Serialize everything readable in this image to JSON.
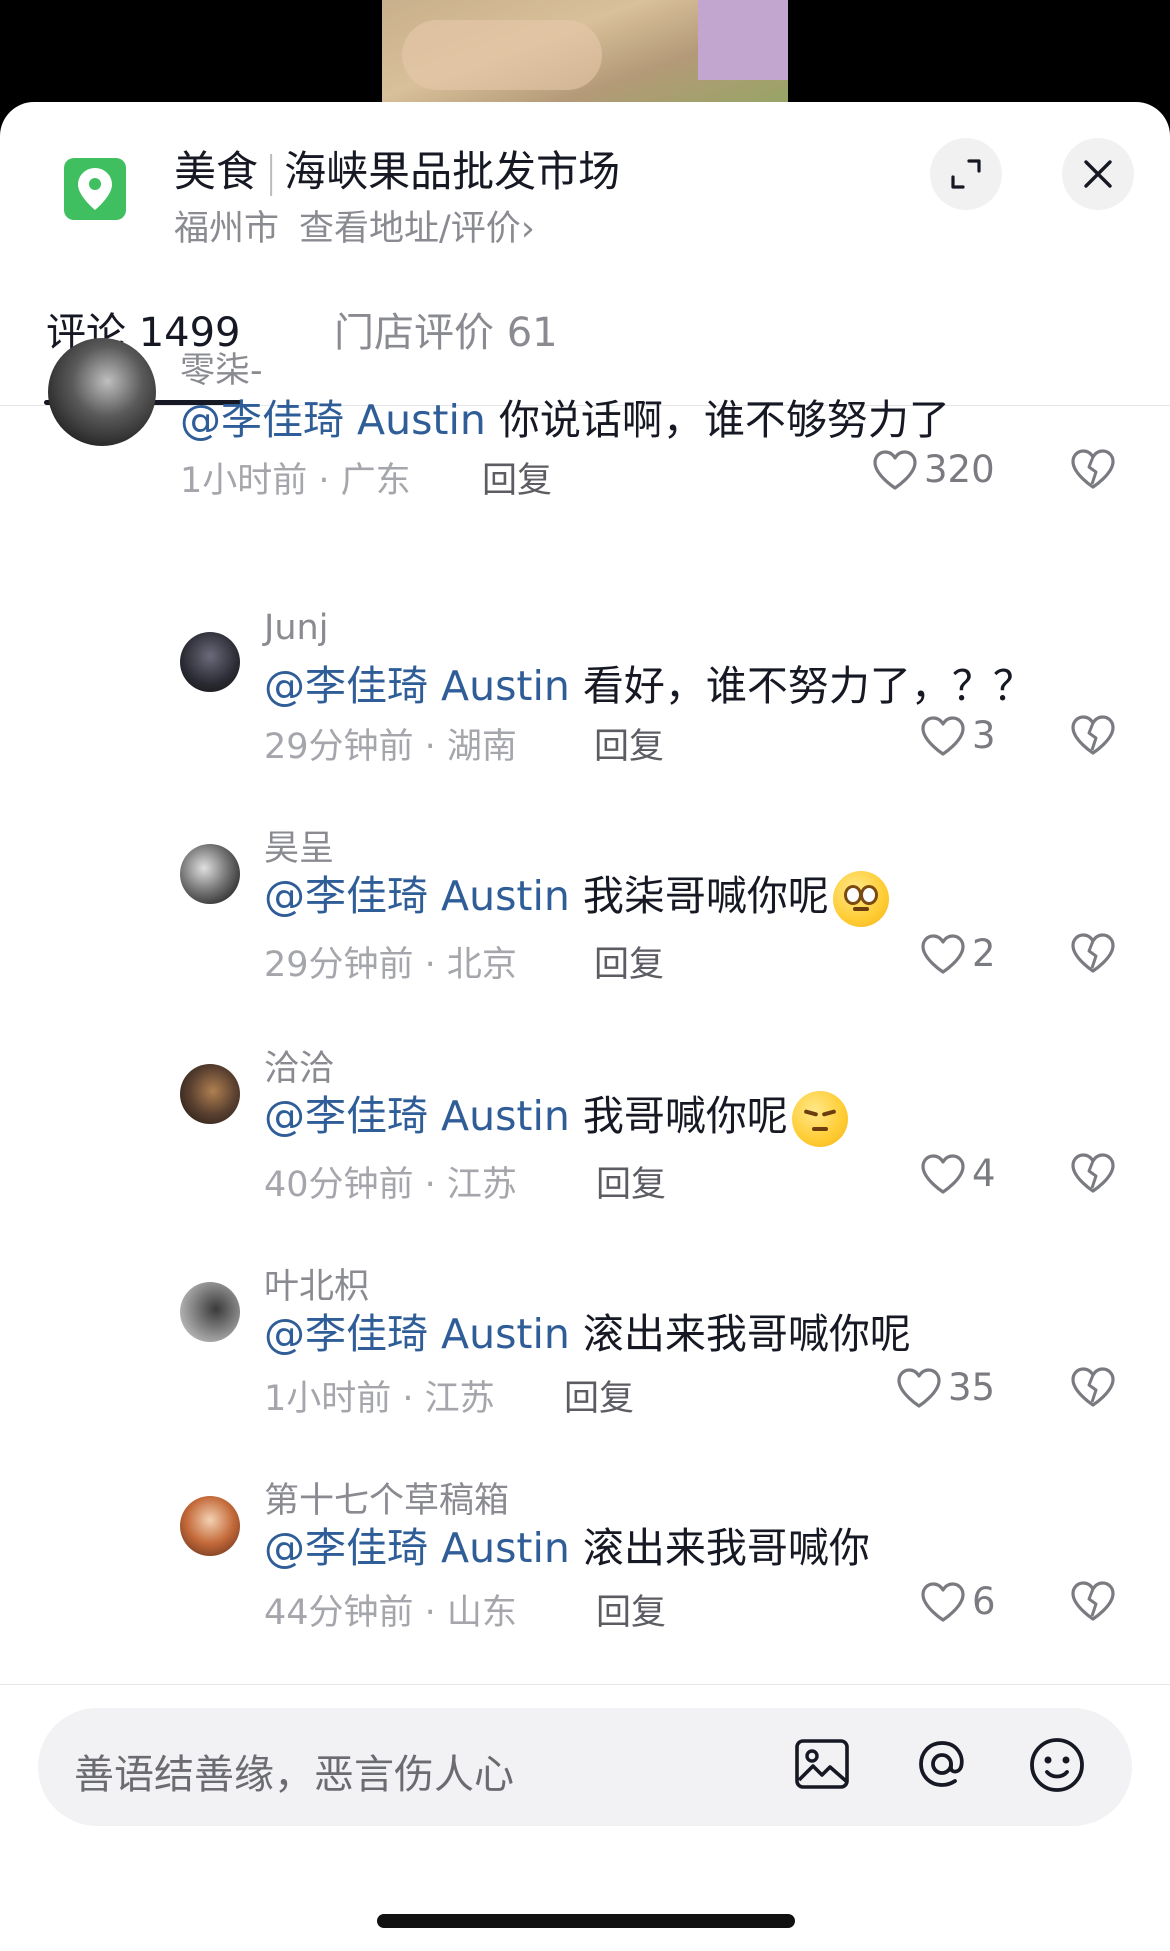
{
  "header": {
    "category": "美食",
    "place_name": "海峡果品批发市场",
    "city": "福州市",
    "address_link": "查看地址/评价",
    "chevron": "›"
  },
  "icons": {
    "location": "location-pin-icon",
    "expand": "expand-icon",
    "close": "close-icon",
    "image": "image-icon",
    "at": "at-mention-icon",
    "emoji": "emoji-icon"
  },
  "tabs": [
    {
      "label": "评论 1499",
      "active": true
    },
    {
      "label": "门店评价 61",
      "active": false
    }
  ],
  "comments": [
    {
      "username": "零柒-",
      "mention": "@李佳琦 Austin",
      "text": " 你说话啊，谁不够努力了",
      "time_location": "1小时前 · 广东",
      "reply_label": "回复",
      "likes": "320"
    },
    {
      "username": "Junj",
      "mention": "@李佳琦 Austin",
      "text": " 看好，谁不努力了，？？",
      "time_location": "29分钟前 · 湖南",
      "reply_label": "回复",
      "likes": "3"
    },
    {
      "username": "昊呈",
      "mention": "@李佳琦 Austin",
      "text": " 我柒哥喊你呢",
      "emoji": "happy-face-emoji",
      "time_location": "29分钟前 · 北京",
      "reply_label": "回复",
      "likes": "2"
    },
    {
      "username": "洽洽",
      "mention": "@李佳琦 Austin",
      "text": " 我哥喊你呢",
      "emoji": "annoyed-face-emoji",
      "time_location": "40分钟前 · 江苏",
      "reply_label": "回复",
      "likes": "4"
    },
    {
      "username": "叶北枳",
      "mention": "@李佳琦 Austin",
      "text": " 滚出来我哥喊你呢",
      "time_location": "1小时前 · 江苏",
      "reply_label": "回复",
      "likes": "35"
    },
    {
      "username": "第十七个草稿箱",
      "mention": "@李佳琦 Austin",
      "text": " 滚出来我哥喊你",
      "time_location": "44分钟前 · 山东",
      "reply_label": "回复",
      "likes": "6"
    }
  ],
  "input": {
    "placeholder": "善语结善缘，恶言伤人心"
  },
  "colors": {
    "mention": "#2f5d97",
    "location_green": "#3fbf5f",
    "text_primary": "#161823",
    "text_secondary": "#8a8b91"
  }
}
